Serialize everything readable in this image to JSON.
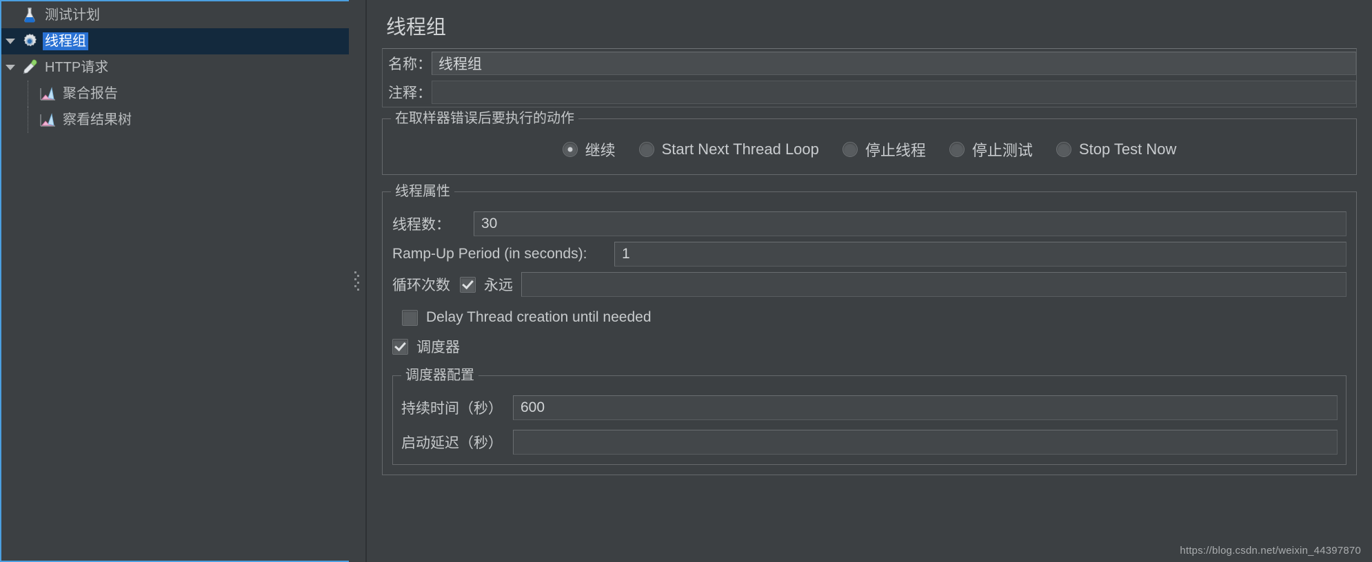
{
  "tree": {
    "items": [
      {
        "label": "测试计划",
        "icon": "flask-icon",
        "depth": 0,
        "twisty": "none",
        "selected": false
      },
      {
        "label": "线程组",
        "icon": "gear-icon",
        "depth": 0,
        "twisty": "expanded",
        "selected": true
      },
      {
        "label": "HTTP请求",
        "icon": "pipette-icon",
        "depth": 0,
        "twisty": "expanded",
        "selected": false
      },
      {
        "label": "聚合报告",
        "icon": "chart-icon",
        "depth": 1,
        "twisty": "none",
        "selected": false
      },
      {
        "label": "察看结果树",
        "icon": "chart-icon",
        "depth": 1,
        "twisty": "none",
        "selected": false
      }
    ]
  },
  "panel": {
    "title": "线程组",
    "name_label": "名称：",
    "name_value": "线程组",
    "comment_label": "注释：",
    "comment_value": ""
  },
  "on_error": {
    "group_title": "在取样器错误后要执行的动作",
    "options": [
      {
        "label": "继续",
        "selected": true
      },
      {
        "label": "Start Next Thread Loop",
        "selected": false
      },
      {
        "label": "停止线程",
        "selected": false
      },
      {
        "label": "停止测试",
        "selected": false
      },
      {
        "label": "Stop Test Now",
        "selected": false
      }
    ]
  },
  "thread_props": {
    "group_title": "线程属性",
    "threads_label": "线程数：",
    "threads_value": "30",
    "rampup_label": "Ramp-Up Period (in seconds):",
    "rampup_value": "1",
    "loop_label": "循环次数",
    "forever_label": "永远",
    "forever_checked": true,
    "loop_value": "",
    "delay_creation_label": "Delay Thread creation until needed",
    "delay_creation_checked": false,
    "scheduler_label": "调度器",
    "scheduler_checked": true
  },
  "scheduler_cfg": {
    "group_title": "调度器配置",
    "duration_label": "持续时间（秒）",
    "duration_value": "600",
    "startup_delay_label": "启动延迟（秒）",
    "startup_delay_value": ""
  },
  "watermark": "https://blog.csdn.net/weixin_44397870",
  "colors": {
    "background": "#3c4043",
    "selection": "#13293d",
    "highlight": "#2a72d4",
    "focus_border": "#4b9fe0",
    "text": "#c8cbcd"
  }
}
